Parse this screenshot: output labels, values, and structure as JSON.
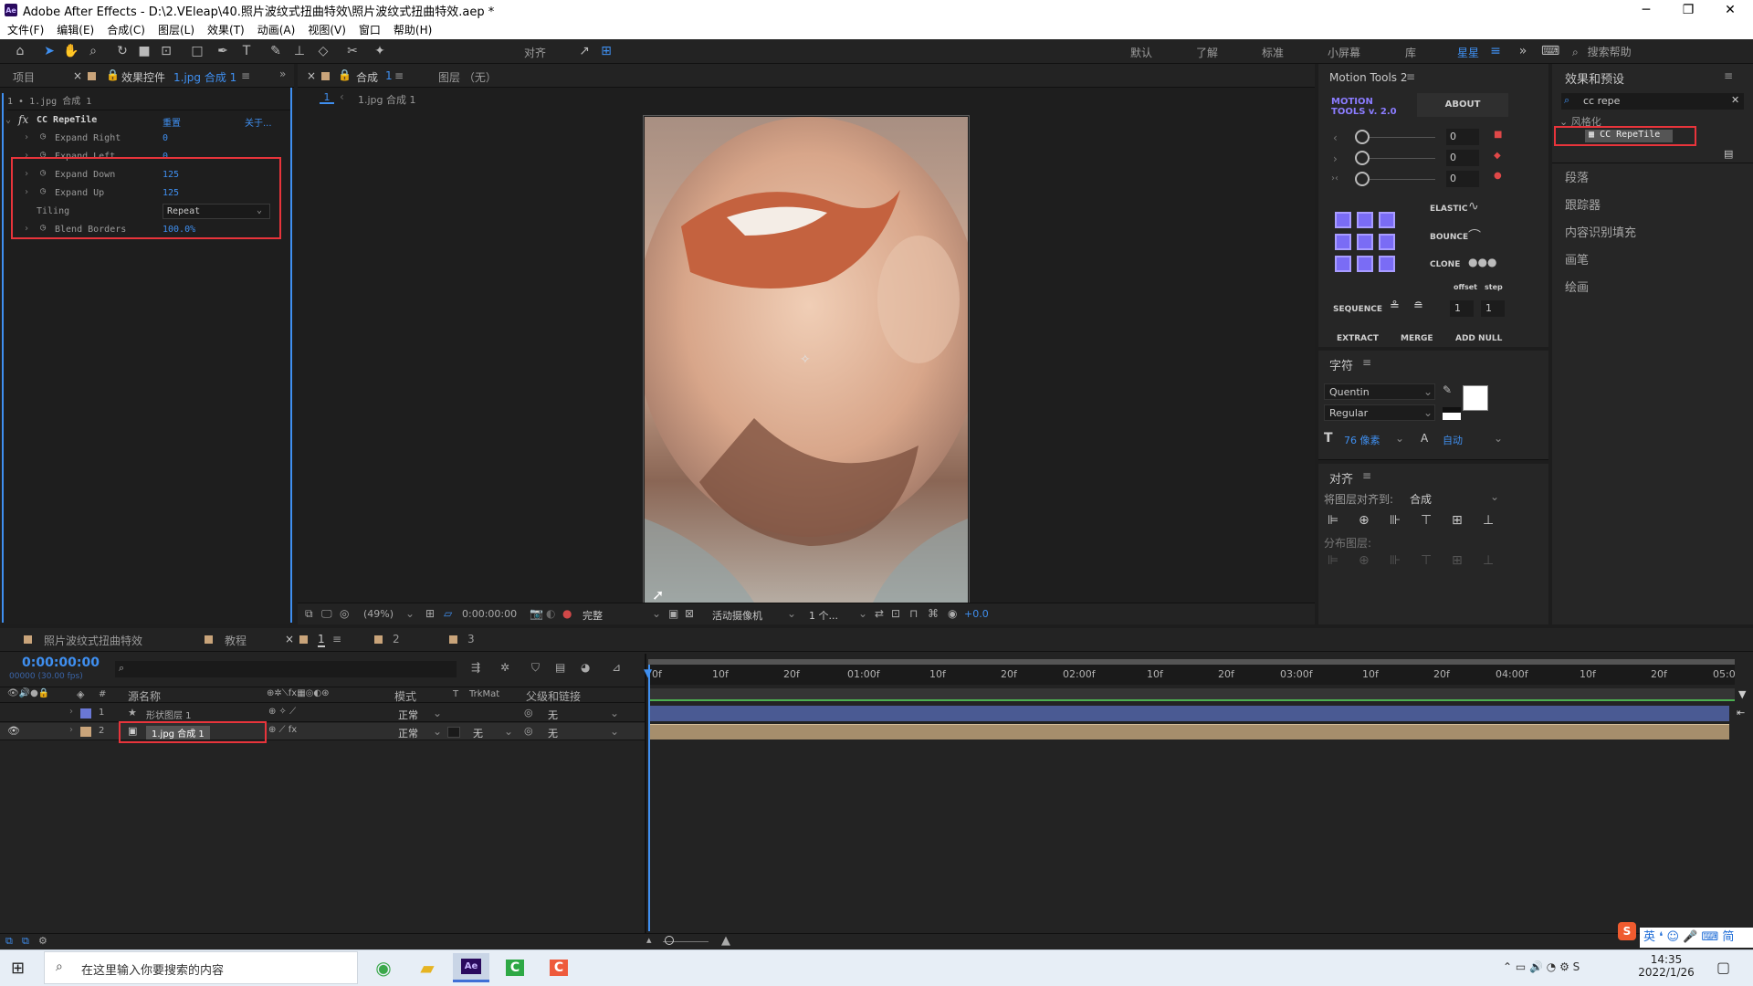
{
  "window": {
    "title": "Adobe After Effects - D:\\2.VEleap\\40.照片波纹式扭曲特效\\照片波纹式扭曲特效.aep *",
    "logo_text": "Ae",
    "minimize": "─",
    "restore": "❐",
    "close": "✕"
  },
  "menu": [
    "文件(F)",
    "编辑(E)",
    "合成(C)",
    "图层(L)",
    "效果(T)",
    "动画(A)",
    "视图(V)",
    "窗口",
    "帮助(H)"
  ],
  "toolbar": {
    "align_label": "对齐",
    "workspaces": [
      "默认",
      "了解",
      "标准",
      "小屏幕",
      "库",
      "星星"
    ],
    "search_help": "搜索帮助"
  },
  "project_panel": {
    "tab_project": "项目",
    "tab_effect_controls": "效果控件",
    "tab_effect_target": "1.jpg 合成 1",
    "breadcrumb": "1 • 1.jpg 合成 1",
    "effect_name": "CC RepeTile",
    "reset": "重置",
    "about": "关于...",
    "properties": [
      {
        "name": "Expand Right",
        "value": "0"
      },
      {
        "name": "Expand Left",
        "value": "0"
      },
      {
        "name": "Expand Down",
        "value": "125"
      },
      {
        "name": "Expand Up",
        "value": "125"
      },
      {
        "name": "Tiling",
        "value": "Repeat"
      },
      {
        "name": "Blend Borders",
        "value": "100.0%"
      }
    ]
  },
  "comp_panel": {
    "tab_comp": "合成",
    "tab_comp_num": "1",
    "tab_layer": "图层 （无）",
    "crumb_num": "1",
    "crumb_name": "1.jpg 合成 1",
    "zoom": "(49%)",
    "timecode": "0:00:00:00",
    "quality": "完整",
    "camera": "活动摄像机",
    "views": "1 个...",
    "exposure": "+0.0"
  },
  "motion_tools": {
    "title": "Motion Tools 2",
    "logo_line1": "MOTION",
    "logo_line2": "TOOLS v. 2.0",
    "about": "ABOUT",
    "slider_values": [
      "0",
      "0",
      "0"
    ],
    "elastic": "ELASTIC",
    "bounce": "BOUNCE",
    "clone": "CLONE",
    "offset": "offset",
    "step": "step",
    "sequence": "SEQUENCE",
    "seq_values": [
      "1",
      "1"
    ],
    "extract": "EXTRACT",
    "merge": "MERGE",
    "add_null": "ADD NULL"
  },
  "character": {
    "title": "字符",
    "font": "Quentin",
    "style": "Regular",
    "size": "76 像素",
    "leading": "自动"
  },
  "align_panel": {
    "title": "对齐",
    "align_to_label": "将图层对齐到:",
    "align_to_value": "合成",
    "distribute": "分布图层:"
  },
  "effects_presets": {
    "title": "效果和预设",
    "search": "cc repe",
    "category": "风格化",
    "result": "CC RepeTile",
    "side_items": [
      "段落",
      "跟踪器",
      "内容识别填充",
      "画笔",
      "绘画"
    ]
  },
  "timeline": {
    "tabs": [
      "照片波纹式扭曲特效",
      "教程",
      "1",
      "2",
      "3"
    ],
    "timecode": "0:00:00:00",
    "fps": "00000 (30.00 fps)",
    "columns": [
      "源名称",
      "模式",
      "T",
      "TrkMat",
      "父级和链接"
    ],
    "layers": [
      {
        "num": "1",
        "name": "形状图层 1",
        "mode": "正常",
        "trkmat": "",
        "parent": "无",
        "color": "#6a78d6"
      },
      {
        "num": "2",
        "name": "1.jpg 合成 1",
        "mode": "正常",
        "trkmat": "无",
        "parent": "无",
        "color": "#c9a47a"
      }
    ],
    "ruler": [
      "0f",
      "10f",
      "20f",
      "01:00f",
      "10f",
      "20f",
      "02:00f",
      "10f",
      "20f",
      "03:00f",
      "10f",
      "20f",
      "04:00f",
      "10f",
      "20f",
      "05:0"
    ]
  },
  "taskbar": {
    "search_placeholder": "在这里输入你要搜索的内容",
    "time": "14:35",
    "date": "2022/1/26",
    "ime": "英"
  },
  "colors": {
    "accent_blue": "#3f8ff0",
    "highlight_red": "#e8343b",
    "panel_bg": "#232323"
  }
}
